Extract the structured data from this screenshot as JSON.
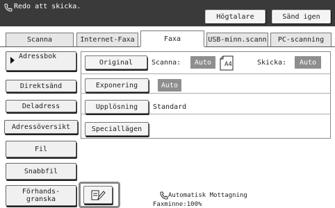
{
  "header": {
    "status_text": "Redo att skicka.",
    "speaker_label": "Högtalare",
    "resend_label": "Sänd igen"
  },
  "tabs": [
    "Scanna",
    "Internet-Faxa",
    "Faxa",
    "USB-minn.scann",
    "PC-scanning"
  ],
  "active_tab": "Faxa",
  "sidebar": {
    "items": [
      "Adressbok",
      "Direktsänd",
      "Deladress",
      "Adressöversikt",
      "Fil",
      "Snabbfil",
      "Förhands-",
      "granska"
    ]
  },
  "settings": {
    "original_label": "Original",
    "scan_label": "Scanna:",
    "scan_value": "Auto",
    "paper_size": "A4",
    "send_label": "Skicka:",
    "send_value": "Auto",
    "exposure_label": "Exponering",
    "exposure_value": "Auto",
    "resolution_label": "Upplösning",
    "resolution_value": "Standard",
    "special_modes_label": "Speciallägen"
  },
  "footer": {
    "auto_receive": "Automatisk Mottagning",
    "fax_memory": "Faxminne:100%"
  },
  "icons": {
    "status": "phone-icon",
    "adressbok": "arrow-right-icon",
    "paper": "a4-paper-icon",
    "tool": "document-edit-icon",
    "receive": "phone-receive-icon"
  }
}
